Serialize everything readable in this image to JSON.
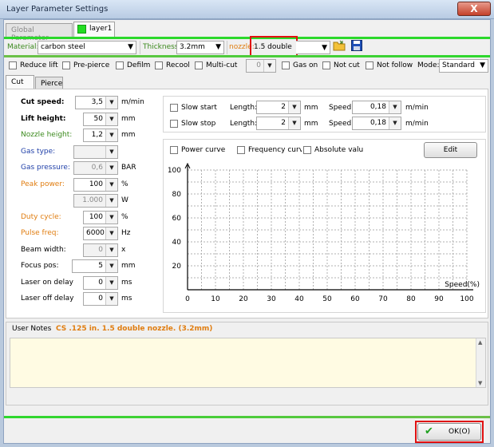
{
  "window": {
    "title": "Layer Parameter Settings",
    "close_label": "X"
  },
  "tabs": [
    {
      "label": "Global Parameter"
    },
    {
      "label": "layer1",
      "color": "#22dd22"
    }
  ],
  "material": {
    "label": "Material:",
    "value": "carbon steel"
  },
  "thickness": {
    "label": "Thickness:",
    "value": "3.2mm"
  },
  "nozzle": {
    "label": "nozzle:",
    "value": "1.5 double"
  },
  "options": {
    "reduce_lift": "Reduce lift",
    "pre_pierce": "Pre-pierce",
    "defilm": "Defilm",
    "recool": "Recool",
    "multi_cut": "Multi-cut",
    "multi_cut_value": "0",
    "gas_on": "Gas on",
    "not_cut": "Not cut",
    "not_follow": "Not follow",
    "mode_label": "Mode:",
    "mode_value": "Standard"
  },
  "subtabs": {
    "cut": "Cut",
    "pierce": "Pierce"
  },
  "params": [
    {
      "label": "Cut speed:",
      "value": "3,5",
      "unit": "m/min"
    },
    {
      "label": "Lift height:",
      "value": "50",
      "unit": "mm"
    },
    {
      "label": "Nozzle height:",
      "value": "1,2",
      "unit": "mm"
    },
    {
      "label": "Gas type:",
      "value": "",
      "unit": ""
    },
    {
      "label": "Gas pressure:",
      "value": "0,6",
      "unit": "BAR"
    },
    {
      "label": "Peak power:",
      "value": "100",
      "unit": "%"
    },
    {
      "label": "",
      "value": "1.000",
      "unit": "W"
    },
    {
      "label": "Duty cycle:",
      "value": "100",
      "unit": "%"
    },
    {
      "label": "Pulse freq:",
      "value": "6000",
      "unit": "Hz"
    },
    {
      "label": "Beam width:",
      "value": "0",
      "unit": "x"
    },
    {
      "label": "Focus pos:",
      "value": "5",
      "unit": "mm"
    },
    {
      "label": "Laser on delay",
      "value": "0",
      "unit": "ms"
    },
    {
      "label": "Laser off delay",
      "value": "0",
      "unit": "ms"
    }
  ],
  "slow": {
    "start_label": "Slow start",
    "stop_label": "Slow stop",
    "length_label": "Length:",
    "speed_label": "Speed:",
    "start_length": "2",
    "start_speed": "0,18",
    "stop_length": "2",
    "stop_speed": "0,18",
    "mm": "mm",
    "mmin": "m/min"
  },
  "curve": {
    "power_curve": "Power curve",
    "frequency_curve": "Frequency curve",
    "absolute_value": "Absolute valu",
    "edit_label": "Edit"
  },
  "chart_data": {
    "type": "line",
    "title": "",
    "xlabel": "Speed(%)",
    "ylabel": "",
    "x_ticks": [
      "0",
      "10",
      "20",
      "30",
      "40",
      "50",
      "60",
      "70",
      "80",
      "90",
      "100"
    ],
    "y_ticks": [
      "20",
      "40",
      "60",
      "80",
      "100"
    ],
    "xlim": [
      0,
      100
    ],
    "ylim": [
      0,
      100
    ],
    "grid": true,
    "series": []
  },
  "notes": {
    "label": "User Notes",
    "text": "CS .125 in. 1.5 double nozzle. (3.2mm)"
  },
  "ok_label": "OK(O)"
}
